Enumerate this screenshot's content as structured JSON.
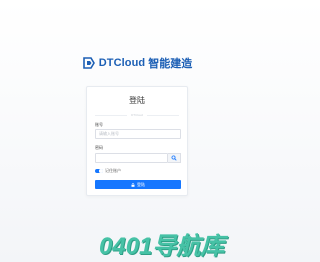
{
  "brand": {
    "name": "DTCloud",
    "sub": "智能建造"
  },
  "login": {
    "title": "登陆",
    "subtitle": "DTCloud",
    "account_label": "账号",
    "account_placeholder": "请输入账号",
    "password_label": "密码",
    "password_placeholder": "",
    "remember_label": "记住账户",
    "remember_on": true,
    "submit_label": "登陆"
  },
  "watermark": "0401导航库",
  "colors": {
    "accent": "#1677ff",
    "brand": "#1c5fb5",
    "watermark": "#46c2a6"
  }
}
